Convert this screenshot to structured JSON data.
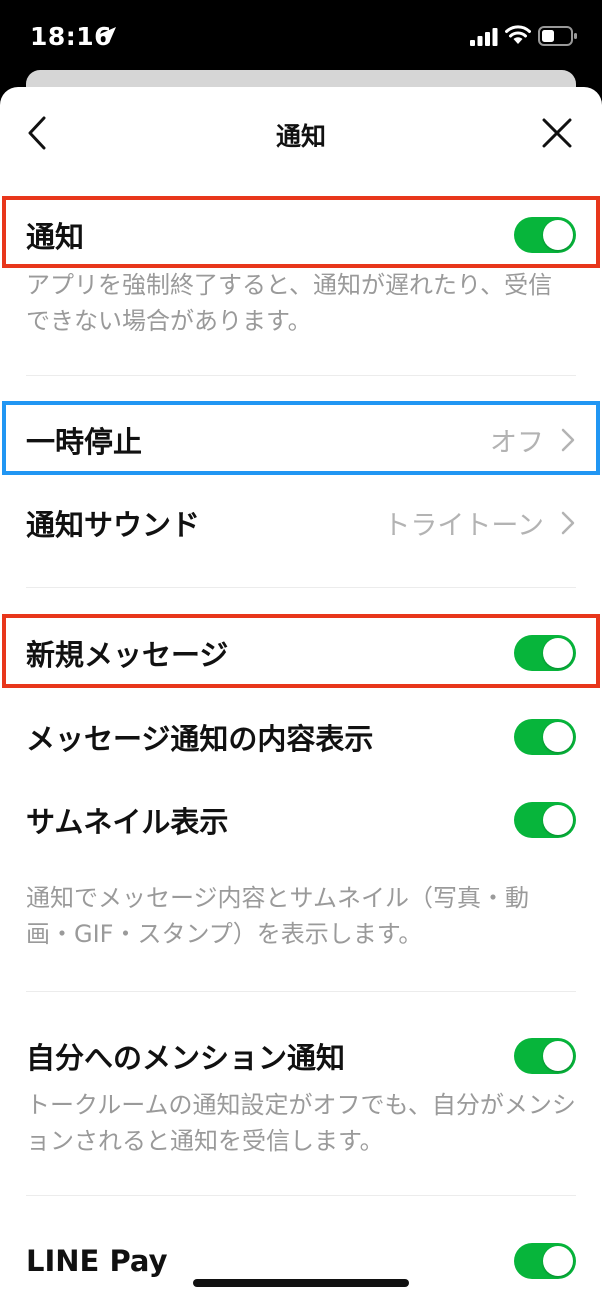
{
  "status_bar": {
    "time": "18:16"
  },
  "nav": {
    "title": "通知"
  },
  "notification": {
    "label": "通知",
    "enabled": true,
    "description": "アプリを強制終了すると、通知が遅れたり、受信できない場合があります。"
  },
  "pause": {
    "label": "一時停止",
    "value": "オフ"
  },
  "sound": {
    "label": "通知サウンド",
    "value": "トライトーン"
  },
  "new_message": {
    "label": "新規メッセージ",
    "enabled": true
  },
  "message_content": {
    "label": "メッセージ通知の内容表示",
    "enabled": true
  },
  "thumbnail": {
    "label": "サムネイル表示",
    "enabled": true,
    "description": "通知でメッセージ内容とサムネイル（写真・動画・GIF・スタンプ）を表示します。"
  },
  "mention": {
    "label": "自分へのメンション通知",
    "enabled": true,
    "description": "トークルームの通知設定がオフでも、自分がメンションされると通知を受信します。"
  },
  "line_pay": {
    "label": "LINE Pay",
    "enabled": true
  },
  "colors": {
    "toggle_on": "#07b53b",
    "highlight_red": "#e8361b",
    "highlight_blue": "#2196f3"
  }
}
